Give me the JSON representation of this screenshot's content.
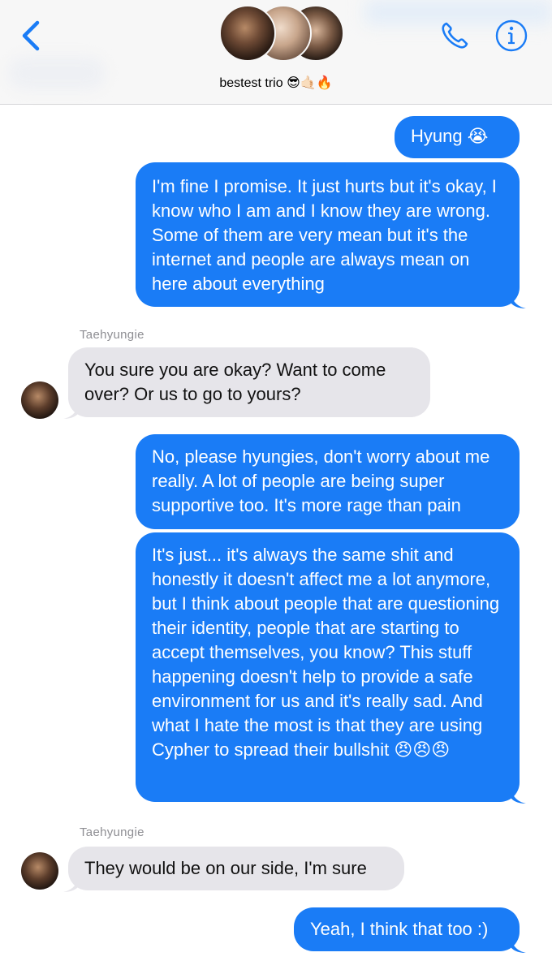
{
  "header": {
    "title": "bestest trio 😎🤙🏻🔥"
  },
  "icons": {
    "back": "chevron-left-icon",
    "call": "phone-icon",
    "info": "info-icon"
  },
  "colors": {
    "accent": "#1a7cf6",
    "incoming_bubble": "#e6e5ea",
    "sender_label": "#8e8e93"
  },
  "messages": [
    {
      "direction": "outgoing",
      "text": "Hyung 😭"
    },
    {
      "direction": "outgoing",
      "text": "I'm fine I promise. It just hurts but it's okay, I know who I am and I know they are wrong. Some of them are very mean but it's the internet and people are always mean on here about everything"
    },
    {
      "direction": "incoming",
      "sender": "Taehyungie",
      "text": "You sure you are okay? Want to come over? Or us to go to yours?"
    },
    {
      "direction": "outgoing",
      "text": "No, please hyungies, don't worry about me really. A lot of people are being super supportive too. It's more rage than pain"
    },
    {
      "direction": "outgoing",
      "text": "It's just... it's always the same shit and honestly it doesn't affect me a lot anymore, but I think about people that are questioning their identity, people that are starting to accept themselves, you know? This stuff happening doesn't help to provide a safe environment for us and it's really sad. And what I hate the most is that they are using Cypher to spread their bullshit 😠😠😠"
    },
    {
      "direction": "incoming",
      "sender": "Taehyungie",
      "text": "They would be on our side, I'm sure"
    },
    {
      "direction": "outgoing",
      "text": "Yeah, I think that too :)"
    }
  ]
}
